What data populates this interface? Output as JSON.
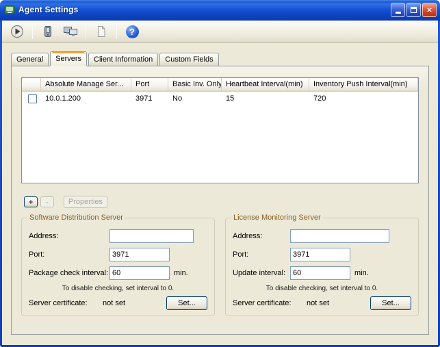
{
  "window": {
    "title": "Agent Settings",
    "controls": {
      "minimize": "minimize",
      "maximize": "maximize",
      "close": "close",
      "close_glyph": "×"
    }
  },
  "toolbar": {
    "icons": [
      {
        "name": "execute-icon"
      },
      {
        "name": "mobile-device-icon"
      },
      {
        "name": "computers-icon"
      },
      {
        "name": "file-icon"
      },
      {
        "name": "help-icon"
      }
    ],
    "help_glyph": "?"
  },
  "tabs": {
    "items": [
      {
        "label": "General"
      },
      {
        "label": "Servers"
      },
      {
        "label": "Client Information"
      },
      {
        "label": "Custom Fields"
      }
    ],
    "active": "Servers"
  },
  "server_table": {
    "columns": [
      "Absolute Manage Ser...",
      "Port",
      "Basic Inv. Only",
      "Heartbeat Interval(min)",
      "Inventory Push Interval(min)"
    ],
    "rows": [
      {
        "checked": false,
        "address": "10.0.1.200",
        "port": "3971",
        "basic_inv_only": "No",
        "heartbeat_interval": "15",
        "inventory_push_interval": "720"
      }
    ]
  },
  "list_buttons": {
    "add": "+",
    "remove": "-",
    "properties": "Properties"
  },
  "groups": {
    "sds": {
      "title": "Software Distribution Server",
      "address_label": "Address:",
      "address_value": "",
      "port_label": "Port:",
      "port_value": "3971",
      "interval_label": "Package check interval:",
      "interval_value": "60",
      "interval_unit": "min.",
      "note": "To disable checking, set interval to 0.",
      "certificate_label": "Server certificate:",
      "certificate_value": "not set",
      "set_button": "Set..."
    },
    "lms": {
      "title": "License Monitoring Server",
      "address_label": "Address:",
      "address_value": "",
      "port_label": "Port:",
      "port_value": "3971",
      "interval_label": "Update interval:",
      "interval_value": "60",
      "interval_unit": "min.",
      "note": "To disable checking, set interval to 0.",
      "certificate_label": "Server certificate:",
      "certificate_value": "not set",
      "set_button": "Set..."
    }
  }
}
